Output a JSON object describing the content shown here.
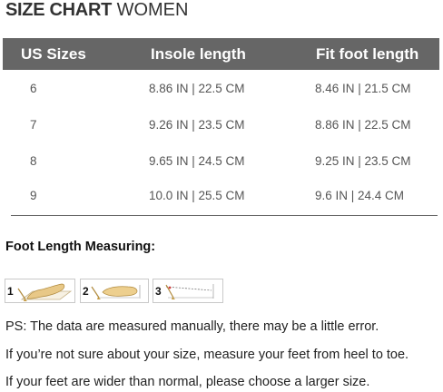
{
  "title": {
    "bold": "SIZE CHART",
    "light": " WOMEN"
  },
  "table": {
    "headers": [
      "US Sizes",
      "Insole length",
      "Fit foot length"
    ],
    "rows": [
      [
        "6",
        "8.86 IN | 22.5 CM",
        "8.46 IN | 21.5 CM"
      ],
      [
        "7",
        "9.26 IN | 23.5 CM",
        "8.86 IN | 22.5 CM"
      ],
      [
        "8",
        "9.65 IN | 24.5 CM",
        "9.25 IN | 23.5 CM"
      ],
      [
        "9",
        "10.0 IN | 25.5 CM",
        "9.6 IN | 24.4 CM"
      ]
    ],
    "header_bg": "#666666"
  },
  "measuring": {
    "title": "Foot Length Measuring:",
    "steps": [
      {
        "number": "1",
        "icon": "foot-on-paper-icon"
      },
      {
        "number": "2",
        "icon": "foot-outline-icon"
      },
      {
        "number": "3",
        "icon": "ruler-measure-icon"
      }
    ]
  },
  "notes": [
    "PS: The data are measured manually, there may be a little error.",
    "If you’re not sure about your size, measure your feet from heel to toe.",
    "If your feet are wider than normal, please choose a larger size."
  ]
}
